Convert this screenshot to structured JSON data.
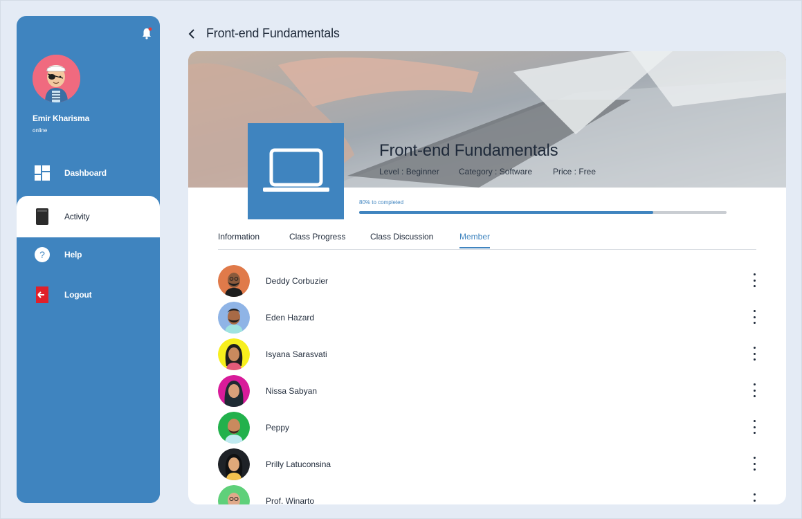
{
  "user": {
    "name": "Emir Kharisma",
    "status": "online"
  },
  "sidebar": {
    "items": [
      {
        "label": "Dashboard",
        "icon": "dashboard-icon"
      },
      {
        "label": "Activity",
        "icon": "book-icon"
      },
      {
        "label": "Help",
        "icon": "help-icon"
      },
      {
        "label": "Logout",
        "icon": "logout-icon"
      }
    ]
  },
  "header": {
    "title": "Front-end Fundamentals"
  },
  "course": {
    "title": "Front-end Fundamentals",
    "level": "Level : Beginner",
    "category": "Category : Software",
    "price": "Price : Free",
    "progress_label": "80% to completed",
    "progress": 0.8
  },
  "tabs": [
    {
      "label": "Information"
    },
    {
      "label": "Class Progress"
    },
    {
      "label": "Class Discussion"
    },
    {
      "label": "Member"
    }
  ],
  "members": [
    {
      "name": "Deddy Corbuzier",
      "color": "#e07a4a"
    },
    {
      "name": "Eden Hazard",
      "color": "#8fb4e6"
    },
    {
      "name": "Isyana Sarasvati",
      "color": "#f7ef1d"
    },
    {
      "name": "Nissa Sabyan",
      "color": "#d81b9a"
    },
    {
      "name": "Peppy",
      "color": "#22b14c"
    },
    {
      "name": "Prilly Latuconsina",
      "color": "#1e2227"
    },
    {
      "name": "Prof. Winarto",
      "color": "#5fd07a"
    }
  ],
  "colors": {
    "accent": "#3f84bf",
    "background": "#e4ebf5"
  }
}
